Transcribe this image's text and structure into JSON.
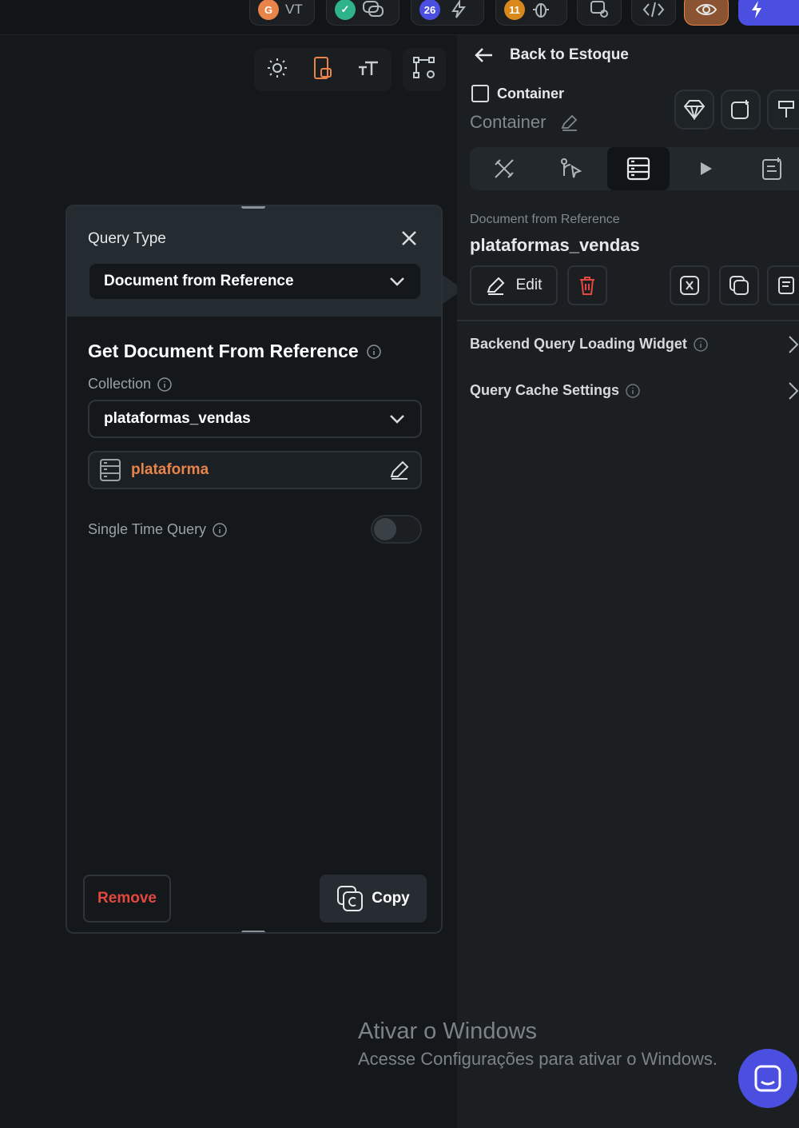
{
  "topbar": {
    "user_initial": "VT",
    "badge_ai": "26",
    "badge_bug": "11"
  },
  "query_panel": {
    "query_type_label": "Query Type",
    "query_type_value": "Document from Reference",
    "section_title": "Get Document From Reference",
    "collection_label": "Collection",
    "collection_value": "plataformas_vendas",
    "reference_value": "plataforma",
    "single_time_query_label": "Single Time Query",
    "single_time_query_on": false,
    "remove_label": "Remove",
    "copy_label": "Copy"
  },
  "right_panel": {
    "back_label": "Back to Estoque",
    "widget_type": "Container",
    "widget_name": "Container",
    "query_kind_label": "Document from Reference",
    "query_collection": "plataformas_vendas",
    "edit_label": "Edit",
    "rows": [
      {
        "label": "Backend Query Loading Widget"
      },
      {
        "label": "Query Cache Settings"
      }
    ]
  },
  "watermark": {
    "title": "Ativar o Windows",
    "subtitle": "Acesse Configurações para ativar o Windows."
  },
  "colors": {
    "accent_orange": "#e8834a",
    "danger": "#e2483d",
    "primary": "#4b4fe0",
    "success": "#2fb38b"
  }
}
